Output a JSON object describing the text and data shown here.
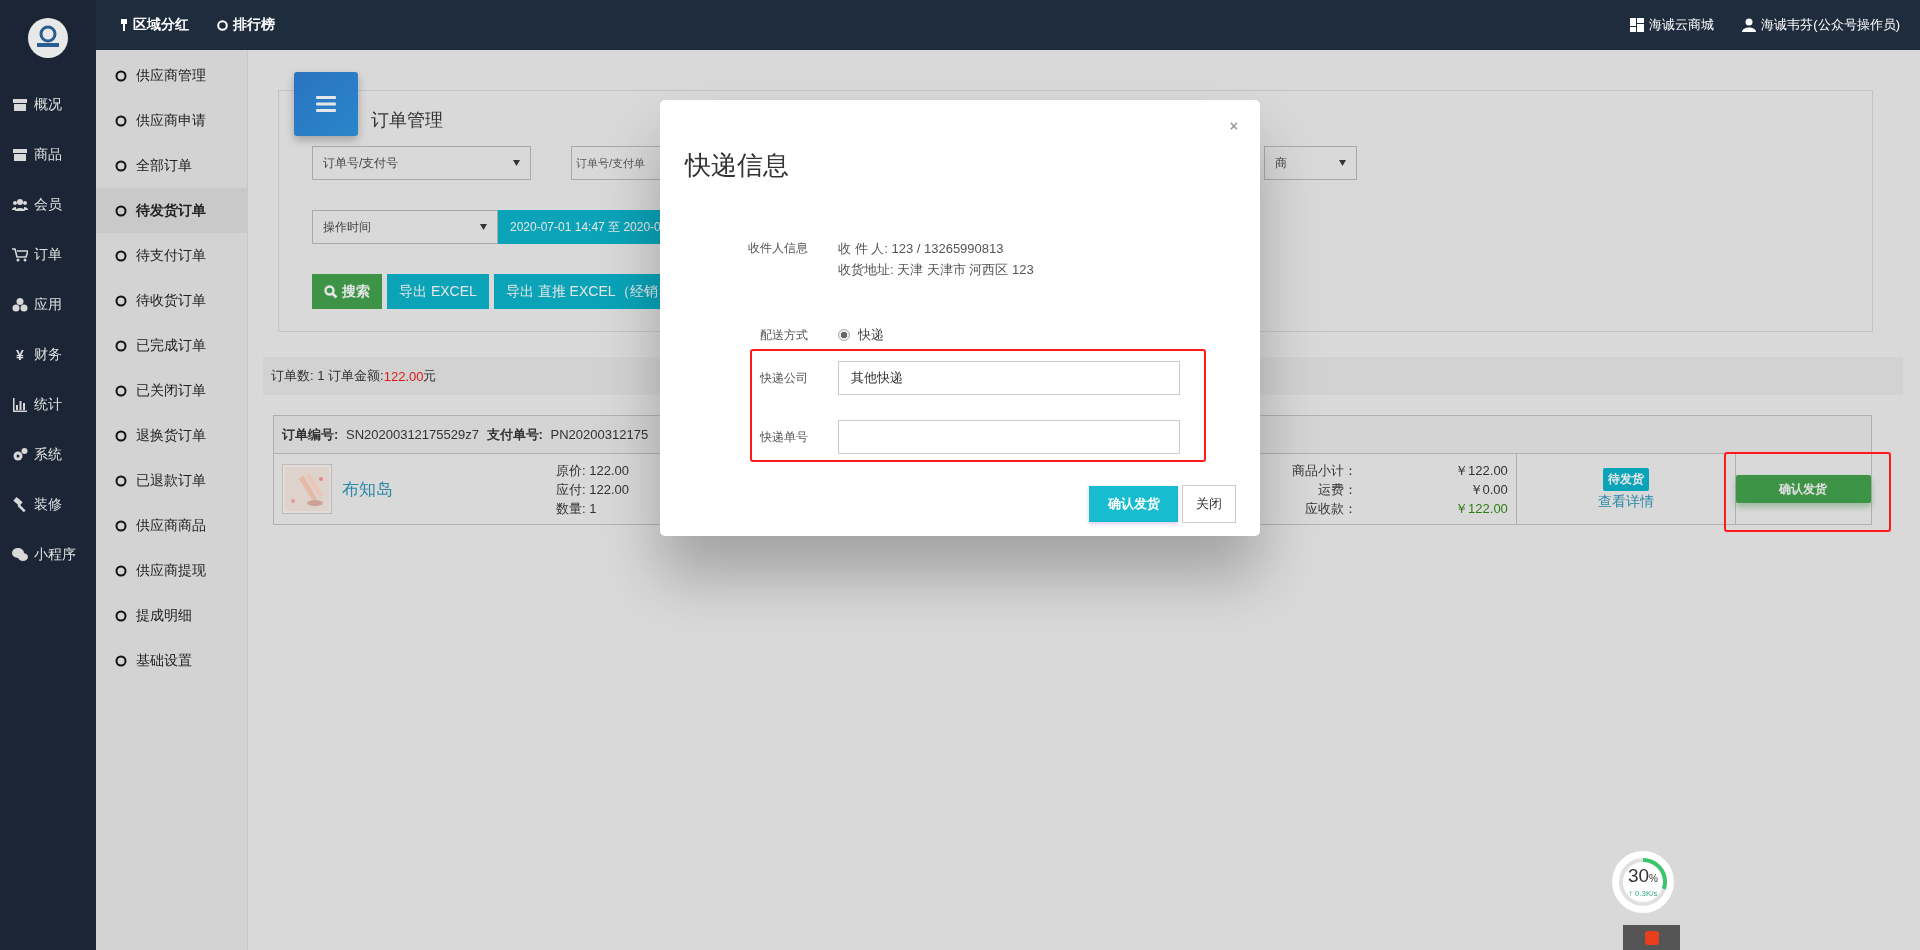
{
  "topbar": {
    "links": [
      {
        "kind": "pin",
        "label": "区域分红"
      },
      {
        "kind": "ring",
        "label": "排行榜"
      }
    ],
    "right": [
      {
        "kind": "grid",
        "label": "海诚云商城"
      },
      {
        "kind": "user",
        "label": "海诚韦芬(公众号操作员)"
      }
    ]
  },
  "nav": [
    {
      "kind": "box",
      "label": "概况"
    },
    {
      "kind": "box",
      "label": "商品"
    },
    {
      "kind": "users",
      "label": "会员"
    },
    {
      "kind": "cart",
      "label": "订单"
    },
    {
      "kind": "cubes",
      "label": "应用"
    },
    {
      "kind": "glyph",
      "glyph": "¥",
      "label": "财务"
    },
    {
      "kind": "chart",
      "label": "统计"
    },
    {
      "kind": "gears",
      "label": "系统"
    },
    {
      "kind": "hammer",
      "label": "装修"
    },
    {
      "kind": "chat",
      "label": "小程序"
    }
  ],
  "subnav": [
    {
      "label": "供应商管理",
      "selected": false
    },
    {
      "label": "供应商申请",
      "selected": false
    },
    {
      "label": "全部订单",
      "selected": false
    },
    {
      "label": "待发货订单",
      "selected": true
    },
    {
      "label": "待支付订单",
      "selected": false
    },
    {
      "label": "待收货订单",
      "selected": false
    },
    {
      "label": "已完成订单",
      "selected": false
    },
    {
      "label": "已关闭订单",
      "selected": false
    },
    {
      "label": "退换货订单",
      "selected": false
    },
    {
      "label": "已退款订单",
      "selected": false
    },
    {
      "label": "供应商商品",
      "selected": false
    },
    {
      "label": "供应商提现",
      "selected": false
    },
    {
      "label": "提成明细",
      "selected": false
    },
    {
      "label": "基础设置",
      "selected": false
    }
  ],
  "panel": {
    "title": "订单管理",
    "search_type": "订单号/支付号",
    "search_placeholder": "订单号/支付单",
    "supplier_select": "商",
    "time_type": "操作时间",
    "date_range": "2020-07-01 14:47 至 2020-0",
    "buttons": [
      {
        "kind": "search",
        "label": "搜索"
      },
      {
        "kind": "export",
        "label": "导出 EXCEL"
      },
      {
        "kind": "export",
        "label": "导出 直推 EXCEL（经销"
      }
    ]
  },
  "summary": {
    "prefix": "订单数: 1 订单金额: ",
    "amount": "122.00",
    "suffix": "元"
  },
  "order": {
    "sn_label": "订单编号:",
    "sn": "SN20200312175529z7",
    "pn_label": "支付单号:",
    "pn": "PN20200312175",
    "product": {
      "name": "布知岛",
      "price": "原价: 122.00",
      "payable": "应付: 122.00",
      "qty": "数量: 1"
    },
    "totals": [
      {
        "label": "商品小计：",
        "value": "￥122.00",
        "highlight": false
      },
      {
        "label": "运费：",
        "value": "￥0.00",
        "highlight": false
      },
      {
        "label": "应收款：",
        "value": "￥122.00",
        "highlight": true
      }
    ],
    "status": "待发货",
    "detail_link": "查看详情",
    "action": "确认发货",
    "action_highlighted": true
  },
  "modal": {
    "title": "快递信息",
    "close": "×",
    "recipient_label": "收件人信息",
    "recipient": "收 件 人: 123 / 13265990813",
    "address": "收货地址: 天津 天津市 河西区 123",
    "delivery_label": "配送方式",
    "delivery_options": [
      {
        "label": "快递",
        "selected": true
      }
    ],
    "fields_highlighted": true,
    "fields": [
      {
        "label": "快递公司",
        "value": "其他快递"
      },
      {
        "label": "快递单号"
      }
    ],
    "confirm": "确认发货",
    "cancel": "关闭"
  },
  "speed": {
    "percent": "30",
    "unit": "%",
    "rate": "↑ 0.3K/s",
    "level": 0.3
  }
}
